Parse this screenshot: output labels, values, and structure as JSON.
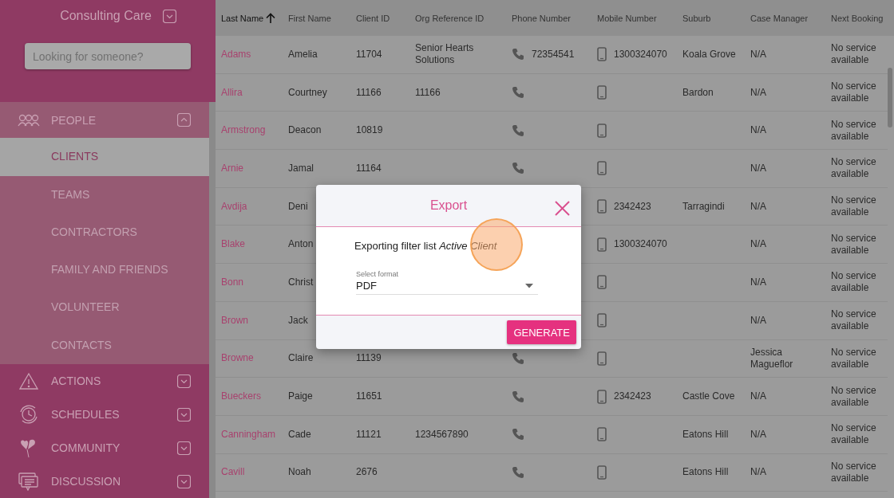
{
  "sidebar": {
    "org_name": "Consulting Care",
    "search": {
      "placeholder": "Looking for someone?"
    },
    "sections": [
      {
        "label": "PEOPLE",
        "expanded": true,
        "items": [
          {
            "label": "CLIENTS",
            "selected": true
          },
          {
            "label": "TEAMS",
            "selected": false
          },
          {
            "label": "CONTRACTORS",
            "selected": false
          },
          {
            "label": "FAMILY AND FRIENDS",
            "selected": false
          },
          {
            "label": "VOLUNTEER",
            "selected": false
          },
          {
            "label": "CONTACTS",
            "selected": false
          }
        ]
      },
      {
        "label": "ACTIONS",
        "expanded": false
      },
      {
        "label": "SCHEDULES",
        "expanded": false
      },
      {
        "label": "COMMUNITY",
        "expanded": false
      },
      {
        "label": "DISCUSSION",
        "expanded": false
      }
    ]
  },
  "table": {
    "columns": [
      {
        "label": "Last Name",
        "sorted": true
      },
      {
        "label": "First Name",
        "sorted": false
      },
      {
        "label": "Client ID",
        "sorted": false
      },
      {
        "label": "Org Reference ID",
        "sorted": false
      },
      {
        "label": "Phone Number",
        "sorted": false
      },
      {
        "label": "Mobile Number",
        "sorted": false
      },
      {
        "label": "Suburb",
        "sorted": false
      },
      {
        "label": "Case Manager",
        "sorted": false
      },
      {
        "label": "Next Booking",
        "sorted": false
      }
    ],
    "rows": [
      {
        "last_name": "Adams",
        "first_name": "Amelia",
        "client_id": "11704",
        "org_reference_id": "Senior Hearts Solutions",
        "phone": "72354541",
        "mobile": "1300324070",
        "suburb": "Koala Grove",
        "case_manager": "N/A",
        "next_booking": "No service available"
      },
      {
        "last_name": "Allira",
        "first_name": "Courtney",
        "client_id": "11166",
        "org_reference_id": "11166",
        "suburb": "Bardon",
        "case_manager": "N/A",
        "next_booking": "No service available"
      },
      {
        "last_name": "Armstrong",
        "first_name": "Deacon",
        "client_id": "10819",
        "case_manager": "N/A",
        "next_booking": "No service available"
      },
      {
        "last_name": "Arnie",
        "first_name": "Jamal",
        "client_id": "11164",
        "case_manager": "N/A",
        "next_booking": "No service available"
      },
      {
        "last_name": "Avdija",
        "first_name": "Deni",
        "mobile": "2342423",
        "suburb": "Tarragindi",
        "case_manager": "N/A",
        "next_booking": "No service available"
      },
      {
        "last_name": "Blake",
        "first_name": "Anton",
        "mobile": "1300324070",
        "case_manager": "N/A",
        "next_booking": "No service available"
      },
      {
        "last_name": "Bonn",
        "first_name": "Christ",
        "case_manager": "N/A",
        "next_booking": "No service available"
      },
      {
        "last_name": "Brown",
        "first_name": "Jack",
        "case_manager": "N/A",
        "next_booking": "No service available"
      },
      {
        "last_name": "Browne",
        "first_name": "Claire",
        "client_id": "11139",
        "case_manager": "Jessica Magueflor",
        "next_booking": "No service available"
      },
      {
        "last_name": "Bueckers",
        "first_name": "Paige",
        "client_id": "11651",
        "mobile": "2342423",
        "suburb": "Castle Cove",
        "case_manager": "N/A",
        "next_booking": "No service available"
      },
      {
        "last_name": "Canningham",
        "first_name": "Cade",
        "client_id": "11121",
        "org_reference_id": "1234567890",
        "suburb": "Eatons Hill",
        "case_manager": "N/A",
        "next_booking": "No service available"
      },
      {
        "last_name": "Cavill",
        "first_name": "Noah",
        "client_id": "2676",
        "suburb": "Eatons Hill",
        "case_manager": "N/A",
        "next_booking": "No service available"
      }
    ]
  },
  "export_dialog": {
    "title": "Export",
    "message": "Exporting filter list *Active Client*",
    "format_label": "Select format",
    "format_value": "PDF",
    "button": "GENERATE"
  }
}
